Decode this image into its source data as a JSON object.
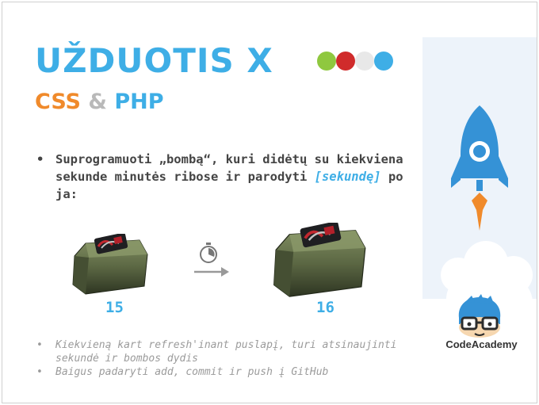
{
  "title": "UŽDUOTIS X",
  "subtitle": {
    "part1": "CSS",
    "part2": "&",
    "part3": "PHP"
  },
  "dots": [
    "#8fc83f",
    "#d02b2b",
    "#e8e8e8",
    "#3eaee6"
  ],
  "task": {
    "text_before": "Suprogramuoti „bombą“, kuri didėtų su kiekviena sekunde minutės ribose ir parodyti ",
    "highlight": "[sekundę]",
    "text_after": " po ja:"
  },
  "bomb_small": {
    "second": "15"
  },
  "bomb_large": {
    "second": "16"
  },
  "icons": [
    "bomb-icon",
    "stopwatch-icon",
    "arrow-right-icon",
    "rocket-icon",
    "codeacademy-logo-icon"
  ],
  "notes": [
    "Kiekvieną kart refresh'inant puslapį, turi atsinaujinti sekundė ir bombos dydis",
    "Baigus padaryti add, commit ir push į GitHub"
  ],
  "brand": "CodeAcademy",
  "colors": {
    "accent": "#3eaee6",
    "orange": "#f08a2b",
    "gray": "#b9b9b9",
    "panel": "#edf3fa"
  }
}
